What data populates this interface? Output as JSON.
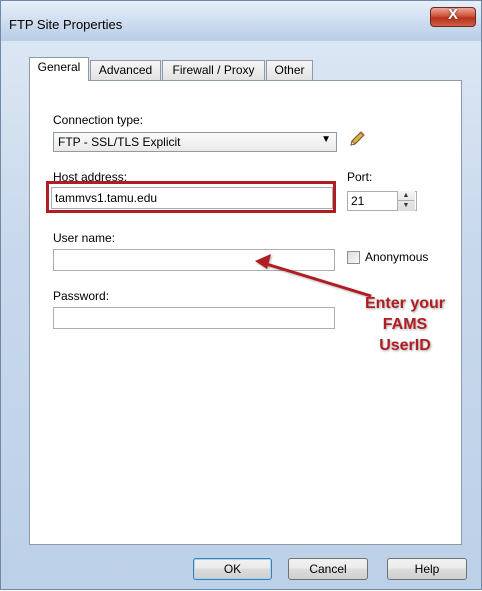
{
  "window": {
    "title": "FTP Site Properties",
    "close_label": "X"
  },
  "tabs": [
    {
      "label": "General",
      "active": true
    },
    {
      "label": "Advanced",
      "active": false
    },
    {
      "label": "Firewall / Proxy",
      "active": false
    },
    {
      "label": "Other",
      "active": false
    }
  ],
  "form": {
    "connection_type_label": "Connection type:",
    "connection_type_value": "FTP - SSL/TLS Explicit",
    "host_label": "Host address:",
    "host_value": "tammvs1.tamu.edu",
    "port_label": "Port:",
    "port_value": "21",
    "username_label": "User name:",
    "username_value": "",
    "anonymous_label": "Anonymous",
    "anonymous_checked": false,
    "password_label": "Password:",
    "password_value": ""
  },
  "annotation": {
    "line1": "Enter your",
    "line2": "FAMS",
    "line3": "UserID",
    "color": "#b01e24"
  },
  "buttons": {
    "ok": "OK",
    "cancel": "Cancel",
    "help": "Help"
  },
  "icons": {
    "edit": "pencil-icon",
    "dropdown": "chevron-down-icon",
    "close": "close-icon"
  }
}
